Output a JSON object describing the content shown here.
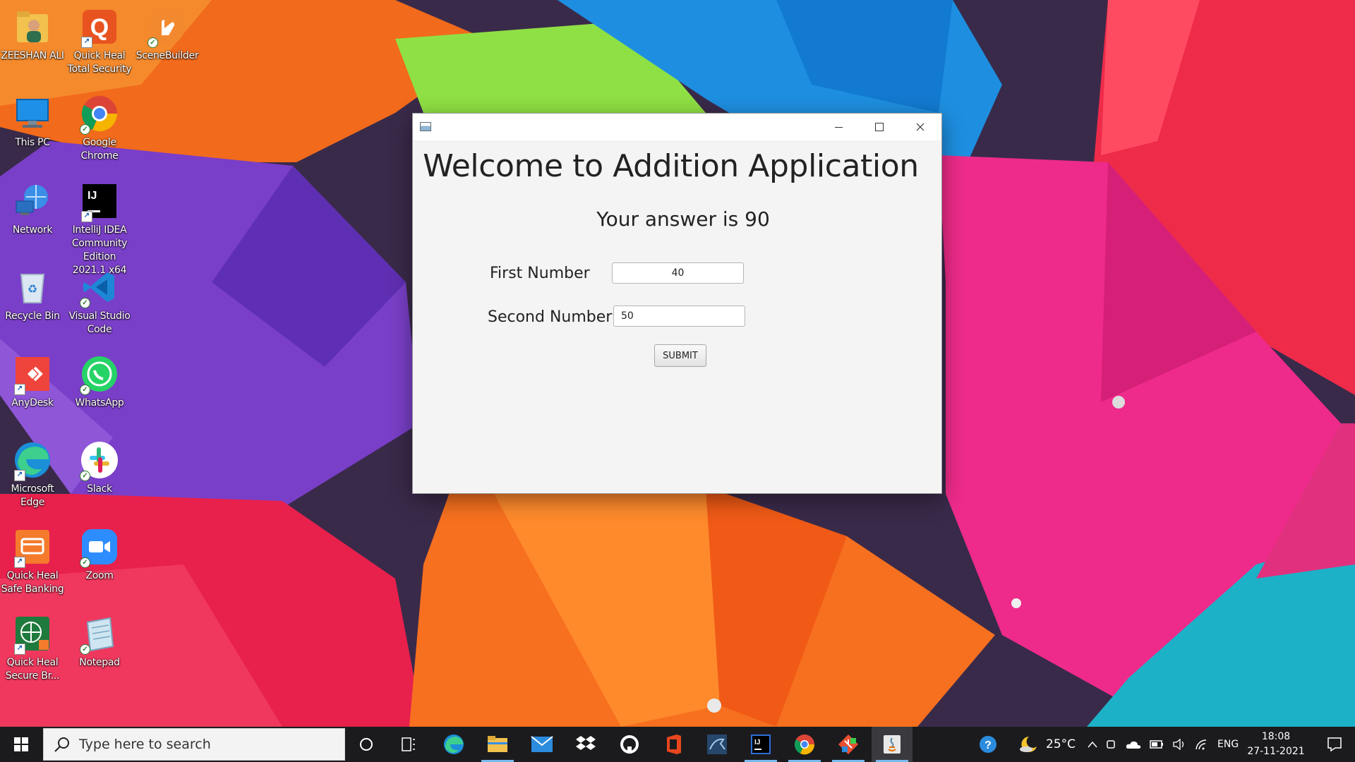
{
  "desktop": {
    "icons": [
      {
        "label": "ZEESHAN ALI"
      },
      {
        "label": "Quick Heal Total Security"
      },
      {
        "label": "SceneBuilder"
      },
      {
        "label": "This PC"
      },
      {
        "label": "Google Chrome"
      },
      {
        "label": "Network"
      },
      {
        "label": "IntelliJ IDEA Community Edition 2021.1 x64"
      },
      {
        "label": "Recycle Bin"
      },
      {
        "label": "Visual Studio Code"
      },
      {
        "label": "AnyDesk"
      },
      {
        "label": "WhatsApp"
      },
      {
        "label": "Microsoft Edge"
      },
      {
        "label": "Slack"
      },
      {
        "label": "Quick Heal Safe Banking"
      },
      {
        "label": "Zoom"
      },
      {
        "label": "Quick Heal Secure Br..."
      },
      {
        "label": "Notepad"
      }
    ]
  },
  "window": {
    "heading": "Welcome to Addition Application",
    "answer": "Your answer is 90",
    "first_label": "First Number",
    "first_value": "40",
    "second_label": "Second Number",
    "second_value": "50",
    "submit_label": "SUBMIT",
    "controls": {
      "minimize": "minimize-icon",
      "maximize": "maximize-icon",
      "close": "close-icon"
    }
  },
  "taskbar": {
    "search_placeholder": "Type here to search",
    "pinned": [
      "cortana-icon",
      "task-view-icon",
      "edge-icon",
      "file-explorer-icon",
      "mail-icon",
      "dropbox-icon",
      "github-icon",
      "office-icon",
      "mysql-workbench-icon",
      "intellij-icon",
      "chrome-icon",
      "git-icon",
      "java-icon"
    ],
    "temperature": "25°C",
    "language": "ENG",
    "time": "18:08",
    "date": "27-11-2021"
  },
  "colors": {
    "taskbar_bg": "#1b1b1e",
    "window_bg": "#f4f4f4",
    "active_indicator": "#76b9ed"
  }
}
